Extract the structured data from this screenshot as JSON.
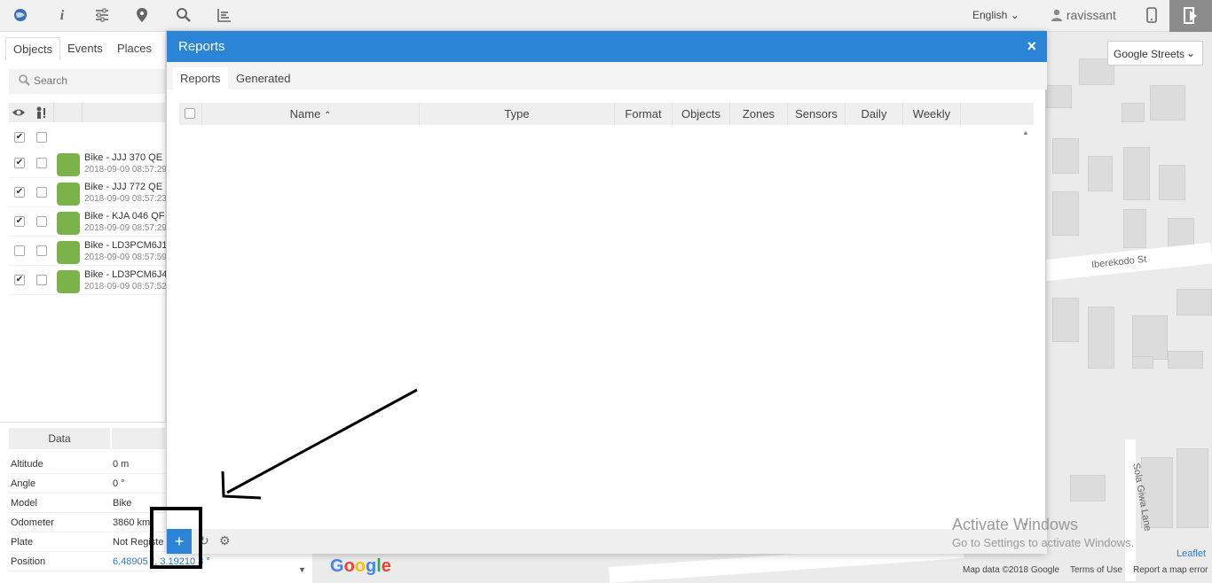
{
  "topbar": {
    "icons": [
      "globe-icon",
      "info-icon",
      "sliders-icon",
      "location-pin-icon",
      "search-icon",
      "chart-icon"
    ],
    "language": "English",
    "username": "ravissant"
  },
  "left": {
    "tabs": [
      "Objects",
      "Events",
      "Places"
    ],
    "search_placeholder": "Search",
    "objects": [
      {
        "name": "Bike - JJJ 370 QE",
        "date": "2018-09-09 08:57:29",
        "visible": true
      },
      {
        "name": "Bike - JJJ 772 QE",
        "date": "2018-09-09 08:57:23",
        "visible": true
      },
      {
        "name": "Bike - KJA 046 QF",
        "date": "2018-09-09 08:57:29",
        "visible": true
      },
      {
        "name": "Bike - LD3PCM6J1",
        "date": "2018-09-09 08:57:59",
        "visible": false
      },
      {
        "name": "Bike - LD3PCM6J4",
        "date": "2018-09-09 08:57:52",
        "visible": true
      }
    ]
  },
  "data_panel": {
    "header": "Data",
    "rows": [
      {
        "key": "Altitude",
        "value": "0 m"
      },
      {
        "key": "Angle",
        "value": "0 °"
      },
      {
        "key": "Model",
        "value": "Bike"
      },
      {
        "key": "Odometer",
        "value": "3860 km"
      },
      {
        "key": "Plate",
        "value": "Not Registe"
      },
      {
        "key": "Position",
        "value": "6.48905  °, 3.19210 3 °"
      }
    ]
  },
  "map": {
    "layer": "Google Streets",
    "streets": [
      "Iberekodo St",
      "Sola Giwa Lane"
    ],
    "attribution": "Map data ©2018 Google",
    "terms": "Terms of Use",
    "report": "Report a map error",
    "leaflet": "Leaflet",
    "google": "Google"
  },
  "watermark": {
    "line1": "Activate Windows",
    "line2": "Go to Settings to activate Windows."
  },
  "dialog": {
    "title": "Reports",
    "close": "×",
    "tabs": [
      "Reports",
      "Generated"
    ],
    "columns": [
      "Name",
      "Type",
      "Format",
      "Objects",
      "Zones",
      "Sensors",
      "Daily",
      "Weekly"
    ],
    "add": "+"
  }
}
